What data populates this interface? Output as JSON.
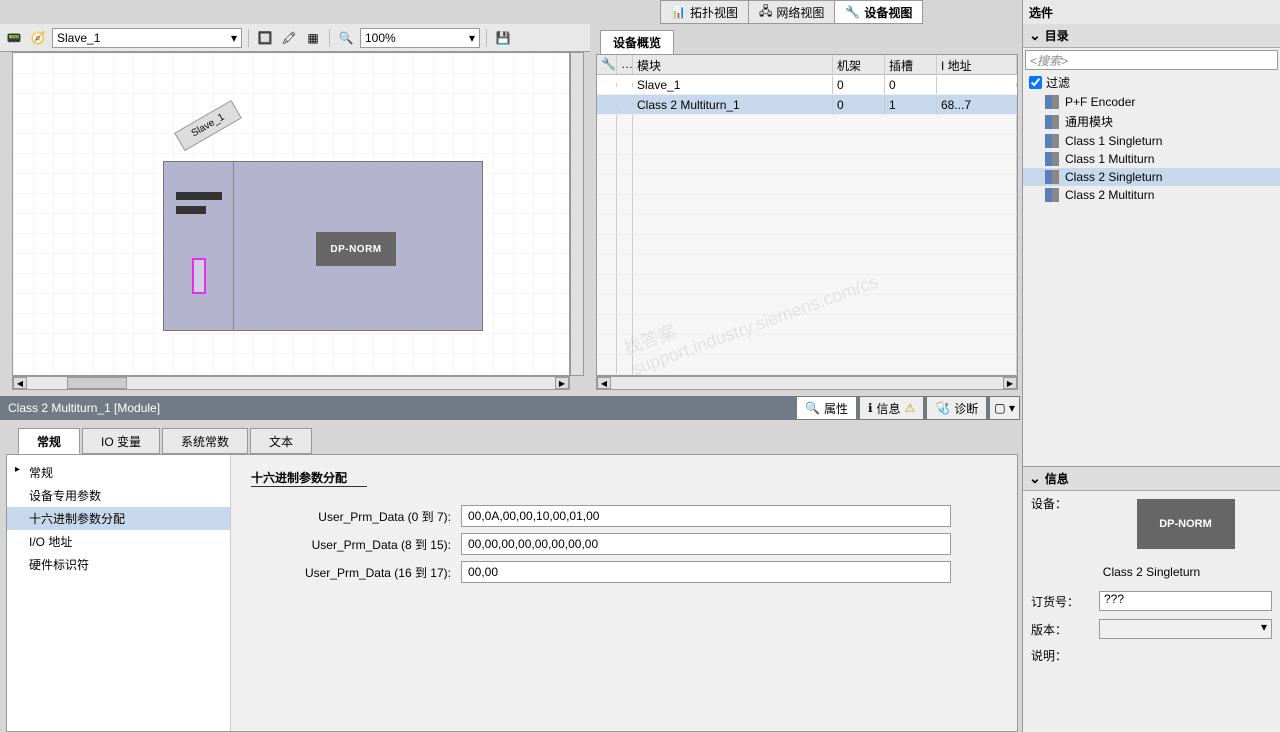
{
  "topTabs": {
    "topology": "拓扑视图",
    "network": "网络视图",
    "device": "设备视图",
    "options": "选件"
  },
  "toolbar": {
    "deviceName": "Slave_1",
    "zoom": "100%"
  },
  "canvas": {
    "slaveLabel": "Slave_1",
    "chipLabel": "DP-NORM"
  },
  "overview": {
    "tabTitle": "设备概览",
    "headers": {
      "module": "模块",
      "rack": "机架",
      "slot": "插槽",
      "addr": "I 地址"
    },
    "rows": [
      {
        "module": "Slave_1",
        "rack": "0",
        "slot": "0",
        "addr": ""
      },
      {
        "module": "Class 2 Multiturn_1",
        "rack": "0",
        "slot": "1",
        "addr": "68...7"
      }
    ]
  },
  "catalog": {
    "title": "目录",
    "searchPlaceholder": "<搜索>",
    "filterLabel": "过滤",
    "items": [
      {
        "label": "P+F  Encoder"
      },
      {
        "label": "通用模块"
      },
      {
        "label": "Class 1 Singleturn"
      },
      {
        "label": "Class 1 Multiturn"
      },
      {
        "label": "Class 2 Singleturn",
        "selected": true
      },
      {
        "label": "Class 2 Multiturn"
      }
    ]
  },
  "info": {
    "title": "信息",
    "deviceLabel": "设备：",
    "previewLabel": "DP-NORM",
    "name": "Class 2 Singleturn",
    "orderLabel": "订货号：",
    "orderValue": "???",
    "versionLabel": "版本：",
    "descLabel": "说明："
  },
  "properties": {
    "titleBar": "Class 2 Multiturn_1 [Module]",
    "rightTabs": {
      "props": "属性",
      "info": "信息",
      "diag": "诊断"
    },
    "tabs": {
      "general": "常规",
      "iovar": "IO 变量",
      "sysconst": "系统常数",
      "text": "文本"
    },
    "nav": {
      "general": "常规",
      "deviceParams": "设备专用参数",
      "hexParams": "十六进制参数分配",
      "ioAddr": "I/O 地址",
      "hwId": "硬件标识符"
    },
    "form": {
      "sectionTitle": "十六进制参数分配",
      "rows": [
        {
          "label": "User_Prm_Data (0 到 7):",
          "value": "00,0A,00,00,10,00,01,00"
        },
        {
          "label": "User_Prm_Data (8 到 15):",
          "value": "00,00,00,00,00,00,00,00"
        },
        {
          "label": "User_Prm_Data (16 到 17):",
          "value": "00,00"
        }
      ]
    }
  }
}
